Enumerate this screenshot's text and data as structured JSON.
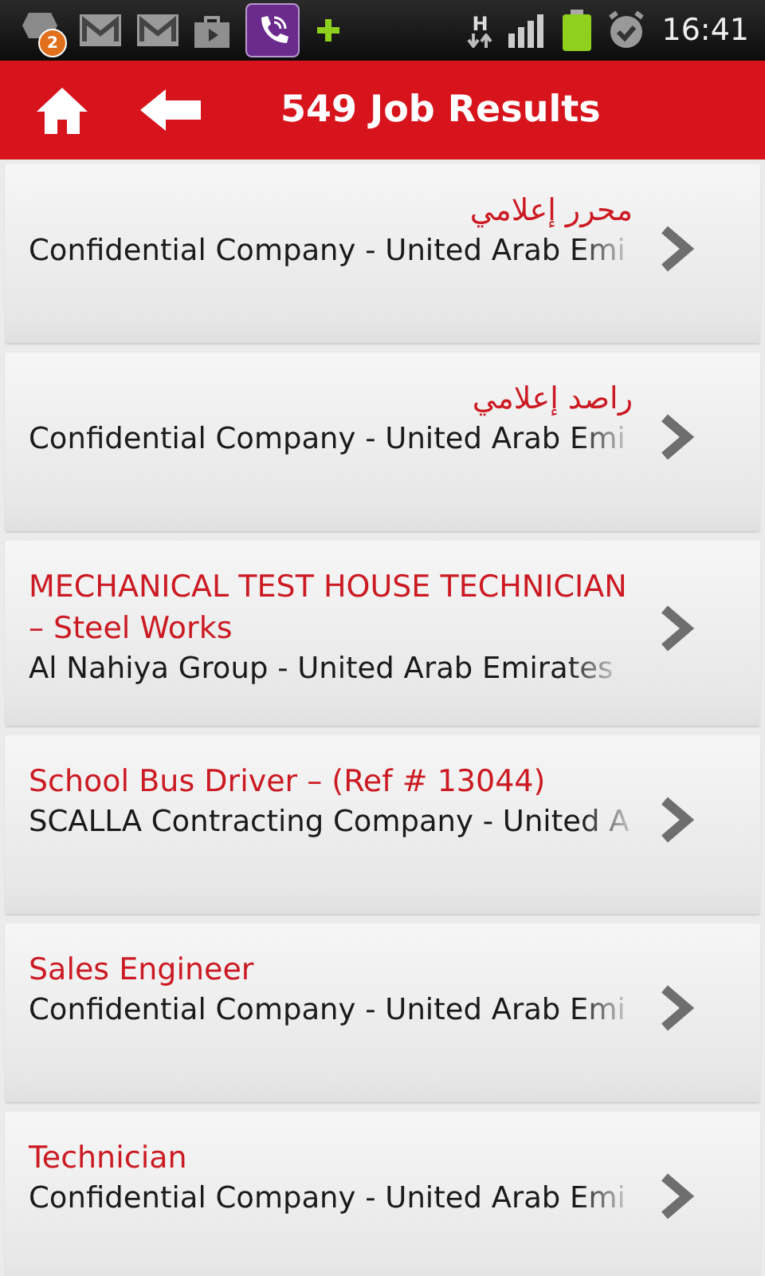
{
  "status_bar": {
    "notification_count": "2",
    "network_type": "H",
    "time": "16:41"
  },
  "header": {
    "title": "549 Job Results"
  },
  "jobs": [
    {
      "title": "محرر إعلامي",
      "company": "Confidential Company - United Arab Emi"
    },
    {
      "title": "راصد إعلامي",
      "company": "Confidential Company - United Arab Emi"
    },
    {
      "title": "MECHANICAL TEST HOUSE TECHNICIAN – Steel Works",
      "company": "Al Nahiya Group - United Arab Emirates"
    },
    {
      "title": "School Bus Driver – (Ref # 13044)",
      "company": "SCALLA Contracting Company - United A"
    },
    {
      "title": "Sales Engineer",
      "company": "Confidential Company - United Arab Emi"
    },
    {
      "title": "Technician",
      "company": "Confidential Company - United Arab Emi"
    }
  ]
}
